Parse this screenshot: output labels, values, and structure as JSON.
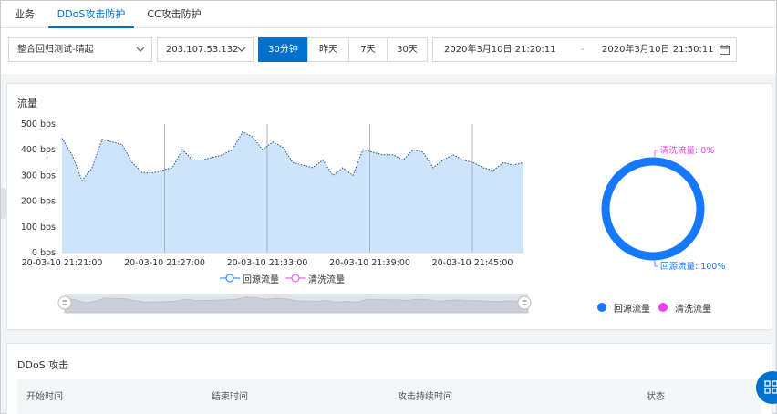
{
  "tabs": [
    {
      "label": "业务"
    },
    {
      "label": "DDoS攻击防护"
    },
    {
      "label": "CC攻击防护"
    }
  ],
  "toolbar": {
    "instance_select": "整合回归测试-晴起",
    "ip_select": "203.107.53.132",
    "time_ranges": [
      "30分钟",
      "昨天",
      "7天",
      "30天"
    ],
    "start_time": "2020年3月10日 21:20:11",
    "separator": "-",
    "end_time": "2020年3月10日 21:50:11"
  },
  "traffic_panel": {
    "title": "流量"
  },
  "colors": {
    "accent": "#0070cc",
    "origin": "#1677ff",
    "scrub": "#f03df0",
    "area_fill": "#cde4fb"
  },
  "chart_data": [
    {
      "type": "area",
      "title": "流量",
      "y_unit": "bps",
      "ylim": [
        0,
        500
      ],
      "y_ticks": [
        "500 bps",
        "400 bps",
        "300 bps",
        "200 bps",
        "100 bps",
        "0 bps"
      ],
      "x_tick_labels": [
        "20-03-10 21:21:00",
        "20-03-10 21:27:00",
        "20-03-10 21:33:00",
        "20-03-10 21:39:00",
        "20-03-10 21:45:00"
      ],
      "series": [
        {
          "name": "回源流量",
          "values": [
            445,
            380,
            280,
            330,
            440,
            430,
            420,
            350,
            310,
            310,
            320,
            330,
            400,
            360,
            360,
            370,
            380,
            400,
            470,
            450,
            400,
            430,
            410,
            350,
            340,
            330,
            360,
            300,
            330,
            300,
            400,
            390,
            380,
            380,
            360,
            400,
            390,
            330,
            360,
            380,
            360,
            350,
            330,
            320,
            350,
            340,
            350
          ]
        },
        {
          "name": "清洗流量",
          "values": [
            0,
            0,
            0,
            0,
            0,
            0,
            0,
            0,
            0,
            0,
            0,
            0,
            0,
            0,
            0,
            0,
            0,
            0,
            0,
            0,
            0,
            0,
            0,
            0,
            0,
            0,
            0,
            0,
            0,
            0,
            0,
            0,
            0,
            0,
            0,
            0,
            0,
            0,
            0,
            0,
            0,
            0,
            0,
            0,
            0,
            0,
            0
          ]
        }
      ],
      "legend": [
        "回源流量",
        "清洗流量"
      ]
    },
    {
      "type": "pie",
      "slices": [
        {
          "name": "清洗流量",
          "percent": 0,
          "label": "清洗流量: 0%"
        },
        {
          "name": "回源流量",
          "percent": 100,
          "label": "回源流量: 100%"
        }
      ],
      "legend": [
        "回源流量",
        "清洗流量"
      ]
    }
  ],
  "attack_panel": {
    "title": "DDoS 攻击",
    "columns": [
      "开始时间",
      "结束时间",
      "攻击持续时间",
      "状态"
    ]
  }
}
